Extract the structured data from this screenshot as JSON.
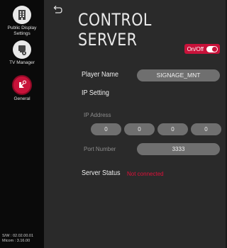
{
  "sidebar": {
    "items": [
      {
        "label_line1": "Public Display",
        "label_line2": "Settings",
        "icon": "building-icon"
      },
      {
        "label_line1": "TV Manager",
        "label_line2": "",
        "icon": "tv-manager-icon"
      },
      {
        "label_line1": "General",
        "label_line2": "",
        "icon": "general-gear-icon"
      }
    ],
    "version_sw": "S/W : 02.02.00.01",
    "version_micom": "Micom : 3.16.00"
  },
  "header": {
    "title": "CONTROL SERVER",
    "toggle_label": "On/Off"
  },
  "form": {
    "player_name_label": "Player Name",
    "player_name_value": "SIGNAGE_MNT",
    "ip_setting_label": "IP Setting",
    "ip_address_label": "IP Address",
    "ip_octets": [
      "0",
      "0",
      "0",
      "0"
    ],
    "port_number_label": "Port Number",
    "port_number_value": "3333",
    "server_status_label": "Server Status",
    "server_status_value": "Not connected"
  },
  "colors": {
    "accent": "#c8123a",
    "status_error": "#e0103a",
    "field_bg": "#6f6f6f"
  }
}
